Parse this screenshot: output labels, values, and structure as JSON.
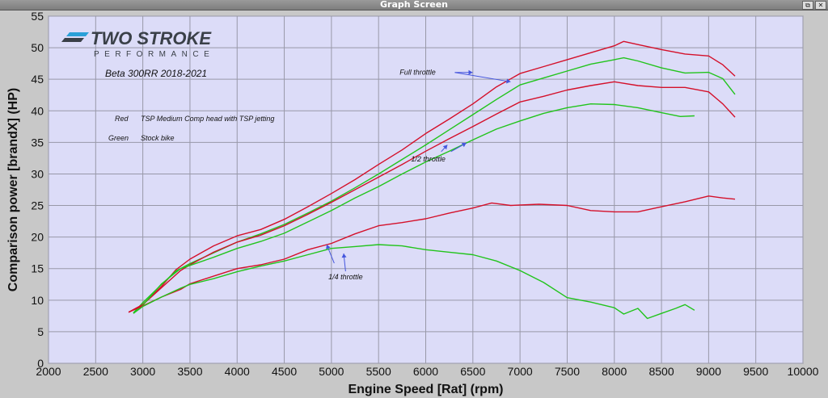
{
  "window": {
    "title": "Graph Screen",
    "restore_glyph": "⧉",
    "close_glyph": "✕"
  },
  "logo": {
    "brand": "TWO STROKE",
    "sub": "PERFORMANCE"
  },
  "colors": {
    "plot_bg": "#dcdcf8",
    "grid": "#9898a8",
    "red": "#d4102a",
    "green": "#22c41c",
    "arrow": "#4455dd",
    "logo_dark": "#3a4048",
    "logo_blue": "#2aa0d8"
  },
  "chart_data": {
    "type": "line",
    "title": "Beta 300RR 2018-2021",
    "xlabel": "Engine Speed [Rat] (rpm)",
    "ylabel": "Comparison power [brandX] (HP)",
    "xlim": [
      2000,
      10000
    ],
    "ylim": [
      0,
      55
    ],
    "xticks": [
      2000,
      2500,
      3000,
      3500,
      4000,
      4500,
      5000,
      5500,
      6000,
      6500,
      7000,
      7500,
      8000,
      8500,
      9000,
      9500,
      10000
    ],
    "yticks": [
      0,
      5,
      10,
      15,
      20,
      25,
      30,
      35,
      40,
      45,
      50,
      55
    ],
    "grid": true,
    "legend": [
      {
        "key": "Red",
        "text": "TSP Medium Comp head with TSP jetting",
        "color": "#d4102a"
      },
      {
        "key": "Green",
        "text": "Stock bike",
        "color": "#22c41c"
      }
    ],
    "annotations": [
      {
        "text": "Full throttle",
        "x": 6240,
        "y": 45.7
      },
      {
        "text": "1/2 throttle",
        "x": 6250,
        "y": 32.0
      },
      {
        "text": "1/4 throttle",
        "x": 5150,
        "y": 13.3
      }
    ],
    "series": [
      {
        "group": "Full throttle",
        "color": "red",
        "x": [
          2850,
          3000,
          3200,
          3350,
          3500,
          3750,
          4000,
          4250,
          4500,
          4750,
          5000,
          5250,
          5500,
          5750,
          6000,
          6250,
          6500,
          6750,
          7000,
          7250,
          7500,
          7750,
          8000,
          8100,
          8250,
          8500,
          8750,
          9000,
          9150,
          9280
        ],
        "y": [
          8.1,
          9.3,
          12.2,
          14.8,
          16.5,
          18.6,
          20.2,
          21.2,
          22.8,
          24.8,
          26.9,
          29.1,
          31.5,
          33.8,
          36.4,
          38.7,
          41.1,
          43.8,
          45.9,
          47.0,
          48.1,
          49.2,
          50.3,
          51.0,
          50.5,
          49.7,
          49.0,
          48.7,
          47.3,
          45.5
        ]
      },
      {
        "group": "Full throttle",
        "color": "green",
        "x": [
          2900,
          3000,
          3200,
          3350,
          3500,
          3750,
          4000,
          4250,
          4500,
          4750,
          5000,
          5250,
          5500,
          5750,
          6000,
          6250,
          6500,
          6750,
          7000,
          7250,
          7500,
          7750,
          8000,
          8100,
          8250,
          8500,
          8750,
          9000,
          9150,
          9280
        ],
        "y": [
          8.0,
          9.6,
          12.5,
          14.6,
          15.8,
          17.5,
          19.2,
          20.5,
          22.0,
          23.8,
          25.7,
          27.8,
          30.0,
          32.3,
          34.6,
          37.0,
          39.4,
          41.8,
          44.1,
          45.2,
          46.3,
          47.4,
          48.1,
          48.4,
          47.9,
          46.8,
          46.0,
          46.1,
          45.1,
          42.6
        ]
      },
      {
        "group": "1/2 throttle",
        "color": "red",
        "x": [
          2850,
          3000,
          3200,
          3400,
          3500,
          3750,
          4000,
          4250,
          4500,
          4750,
          5000,
          5250,
          5500,
          5750,
          6000,
          6250,
          6500,
          6750,
          7000,
          7250,
          7500,
          7750,
          8000,
          8250,
          8500,
          8750,
          9000,
          9150,
          9280
        ],
        "y": [
          8.1,
          9.3,
          12.0,
          14.7,
          15.6,
          17.6,
          19.2,
          20.3,
          21.8,
          23.6,
          25.5,
          27.5,
          29.5,
          31.5,
          33.6,
          35.6,
          37.5,
          39.5,
          41.4,
          42.3,
          43.3,
          44.0,
          44.6,
          44.0,
          43.7,
          43.7,
          43.0,
          41.1,
          39.0
        ]
      },
      {
        "group": "1/2 throttle",
        "color": "green",
        "x": [
          2900,
          3000,
          3200,
          3400,
          3500,
          3750,
          4000,
          4250,
          4500,
          4750,
          5000,
          5250,
          5500,
          5750,
          6000,
          6250,
          6500,
          6750,
          7000,
          7250,
          7500,
          7750,
          8000,
          8250,
          8500,
          8700,
          8850
        ],
        "y": [
          7.9,
          9.2,
          12.6,
          15.0,
          15.5,
          16.8,
          18.2,
          19.3,
          20.6,
          22.4,
          24.2,
          26.2,
          28.0,
          30.0,
          31.9,
          33.6,
          35.4,
          37.1,
          38.4,
          39.6,
          40.5,
          41.1,
          41.0,
          40.5,
          39.7,
          39.1,
          39.2
        ]
      },
      {
        "group": "1/4 throttle",
        "color": "red",
        "x": [
          2850,
          3000,
          3200,
          3400,
          3500,
          3750,
          4000,
          4250,
          4500,
          4750,
          5000,
          5250,
          5500,
          5750,
          6000,
          6250,
          6500,
          6700,
          6900,
          7200,
          7500,
          7750,
          8000,
          8250,
          8500,
          8750,
          9000,
          9150,
          9280
        ],
        "y": [
          8.1,
          9.1,
          10.5,
          11.7,
          12.6,
          13.8,
          15.0,
          15.6,
          16.5,
          18.0,
          19.0,
          20.5,
          21.8,
          22.3,
          22.9,
          23.8,
          24.6,
          25.4,
          25.0,
          25.2,
          25.0,
          24.2,
          24.0,
          24.0,
          24.8,
          25.6,
          26.5,
          26.2,
          26.0
        ]
      },
      {
        "group": "1/4 throttle",
        "color": "green",
        "x": [
          2900,
          3000,
          3200,
          3400,
          3500,
          3750,
          4000,
          4250,
          4500,
          4750,
          5000,
          5250,
          5500,
          5750,
          6000,
          6250,
          6500,
          6750,
          7000,
          7250,
          7500,
          7750,
          8000,
          8100,
          8250,
          8350,
          8500,
          8650,
          8750,
          8850
        ],
        "y": [
          7.9,
          9.0,
          10.5,
          11.9,
          12.5,
          13.4,
          14.5,
          15.4,
          16.2,
          17.2,
          18.2,
          18.5,
          18.8,
          18.6,
          18.0,
          17.6,
          17.2,
          16.2,
          14.7,
          12.8,
          10.4,
          9.7,
          8.8,
          7.8,
          8.7,
          7.1,
          7.9,
          8.7,
          9.3,
          8.4
        ]
      }
    ]
  }
}
